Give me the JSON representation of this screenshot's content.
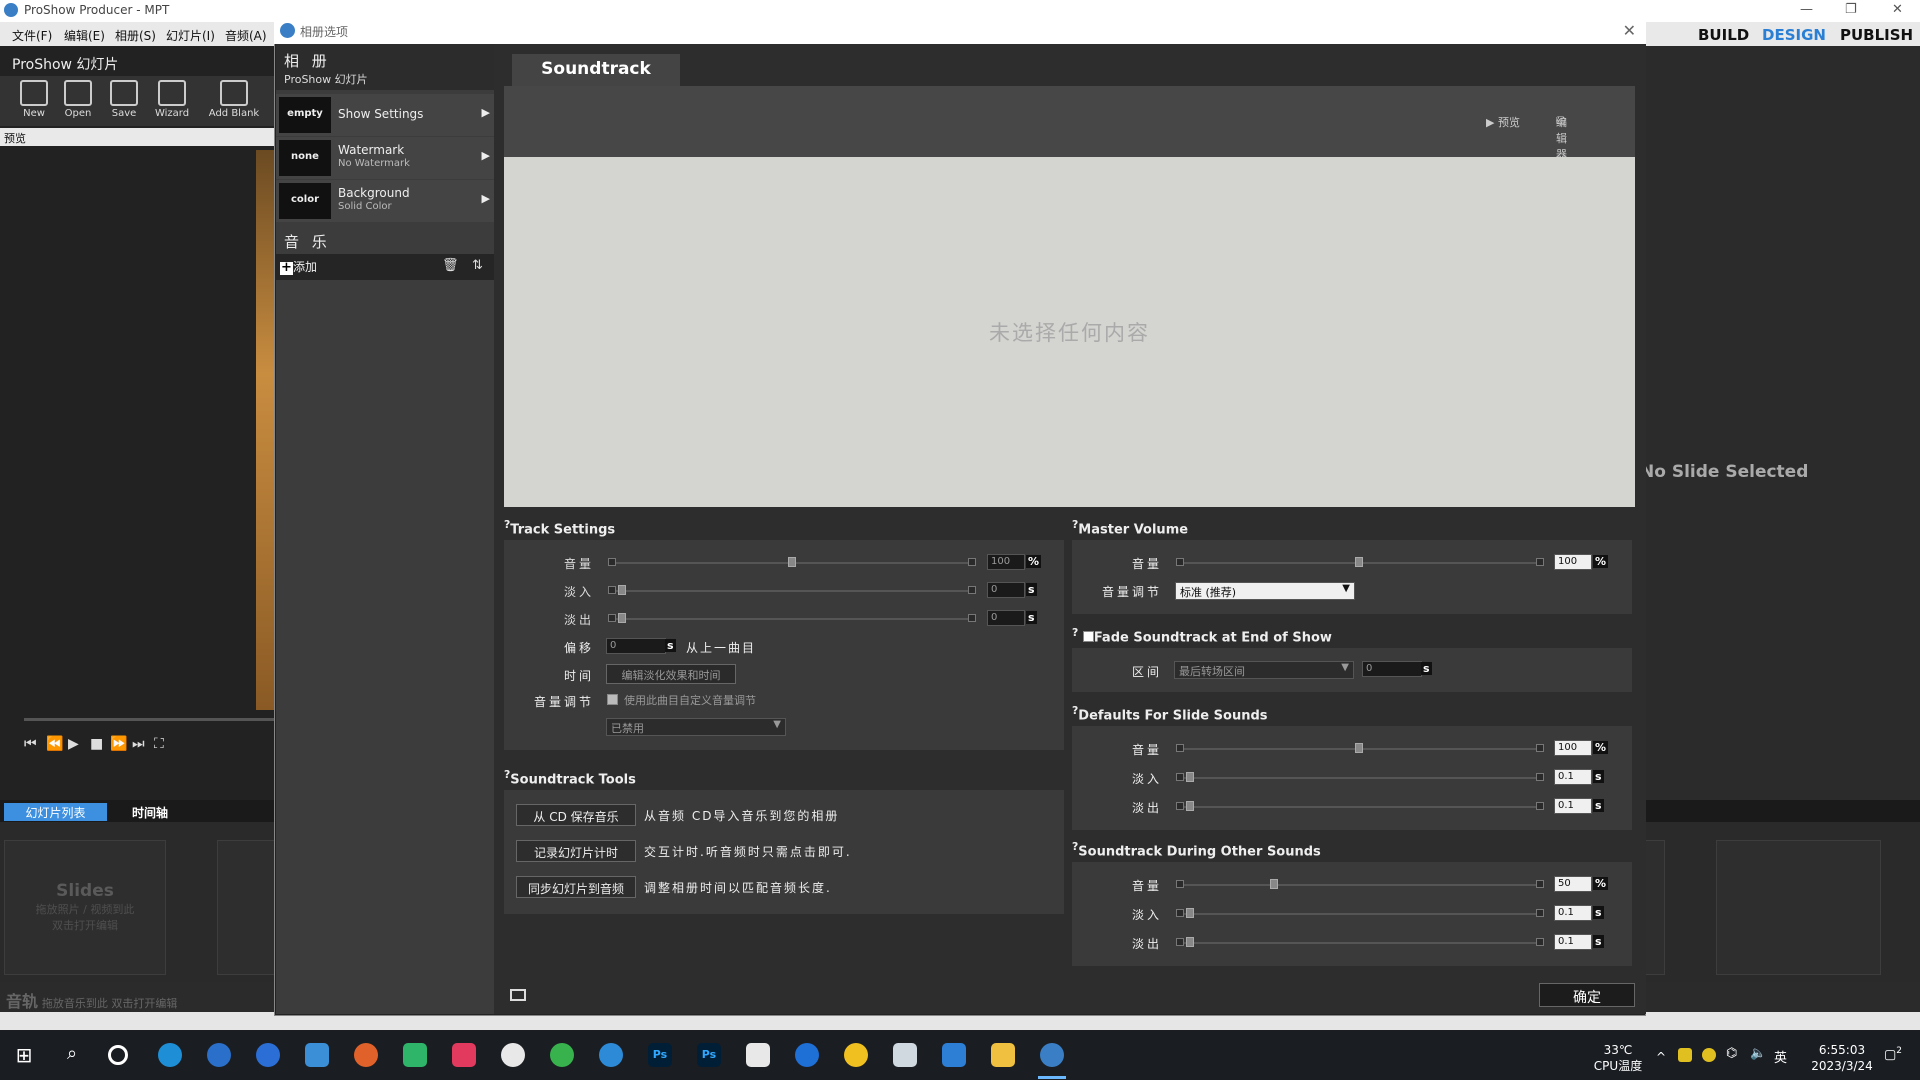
{
  "app": {
    "window_title": "ProShow Producer - MPT",
    "menus": [
      "文件(F)",
      "编辑(E)",
      "相册(S)",
      "幻灯片(I)",
      "音频(A)"
    ],
    "nav": {
      "build": "BUILD",
      "design": "DESIGN",
      "publish": "PUBLISH"
    },
    "show_title": "ProShow 幻灯片",
    "toolbar": [
      "New",
      "Open",
      "Save",
      "Wizard",
      "Add Blank"
    ],
    "preview_label": "预览",
    "no_slide": "No Slide Selected",
    "tabs": [
      "幻灯片列表",
      "时间轴"
    ],
    "slides_hint": {
      "title": "Slides",
      "line1": "拖放照片 / 视频到此",
      "line2": "双击打开编辑"
    },
    "audio_track": {
      "label": "音轨",
      "hint": "拖放音乐到此  双击打开编辑"
    }
  },
  "dialog": {
    "title": "相册选项",
    "album": {
      "title": "相 册",
      "subtitle": "ProShow 幻灯片"
    },
    "nav_items": [
      {
        "thumb": "empty",
        "label": "Show Settings",
        "sub": ""
      },
      {
        "thumb": "none",
        "label": "Watermark",
        "sub": "No Watermark"
      },
      {
        "thumb": "color",
        "label": "Background",
        "sub": "Solid Color"
      }
    ],
    "music_header": "音 乐",
    "add_label": "添加",
    "tab": "Soundtrack",
    "preview_btns": {
      "play": "▶ 预览",
      "editor": "编辑器"
    },
    "stage_message": "未选择任何内容",
    "track_settings": {
      "header": "Track Settings",
      "volume_label": "音量",
      "volume_value": "100",
      "volume_unit": "%",
      "fadein_label": "淡入",
      "fadein_value": "0",
      "fadein_unit": "s",
      "fadeout_label": "淡出",
      "fadeout_value": "0",
      "fadeout_unit": "s",
      "offset_label": "偏移",
      "offset_value": "0",
      "offset_unit": "s",
      "offset_desc": "从上一曲目",
      "time_label": "时间",
      "time_btn": "编辑淡化效果和时间",
      "adjust_label": "音量调节",
      "adjust_check": "使用此曲目自定义音量调节",
      "adjust_select": "已禁用"
    },
    "tools": {
      "header": "Soundtrack Tools",
      "items": [
        {
          "btn": "从 CD 保存音乐",
          "desc": "从音频 CD导入音乐到您的相册"
        },
        {
          "btn": "记录幻灯片计时",
          "desc": "交互计时.听音频时只需点击即可."
        },
        {
          "btn": "同步幻灯片到音频",
          "desc": "调整相册时间以匹配音频长度."
        }
      ]
    },
    "master": {
      "header": "Master Volume",
      "volume_label": "音量",
      "volume_value": "100",
      "volume_unit": "%",
      "adjust_label": "音量调节",
      "adjust_select": "标准 (推荐)"
    },
    "fade_end": {
      "header": "Fade Soundtrack at End of Show",
      "range_label": "区间",
      "range_select": "最后转场区间",
      "range_value": "0",
      "range_unit": "s"
    },
    "slide_defaults": {
      "header": "Defaults For Slide Sounds",
      "volume_label": "音量",
      "volume_value": "100",
      "volume_unit": "%",
      "fadein_label": "淡入",
      "fadein_value": "0.1",
      "fadein_unit": "s",
      "fadeout_label": "淡出",
      "fadeout_value": "0.1",
      "fadeout_unit": "s"
    },
    "other_sounds": {
      "header": "Soundtrack During Other Sounds",
      "volume_label": "音量",
      "volume_value": "50",
      "volume_unit": "%",
      "fadein_label": "淡入",
      "fadein_value": "0.1",
      "fadein_unit": "s",
      "fadeout_label": "淡出",
      "fadeout_value": "0.1",
      "fadeout_unit": "s"
    },
    "ok": "确定"
  },
  "taskbar": {
    "temp": "33℃",
    "temp_label": "CPU温度",
    "time": "6:55:03",
    "date": "2023/3/24",
    "ime": "英",
    "notif": "2"
  },
  "colors": {
    "accent": "#3d8fe0",
    "design_nav": "#2a7fd4"
  }
}
